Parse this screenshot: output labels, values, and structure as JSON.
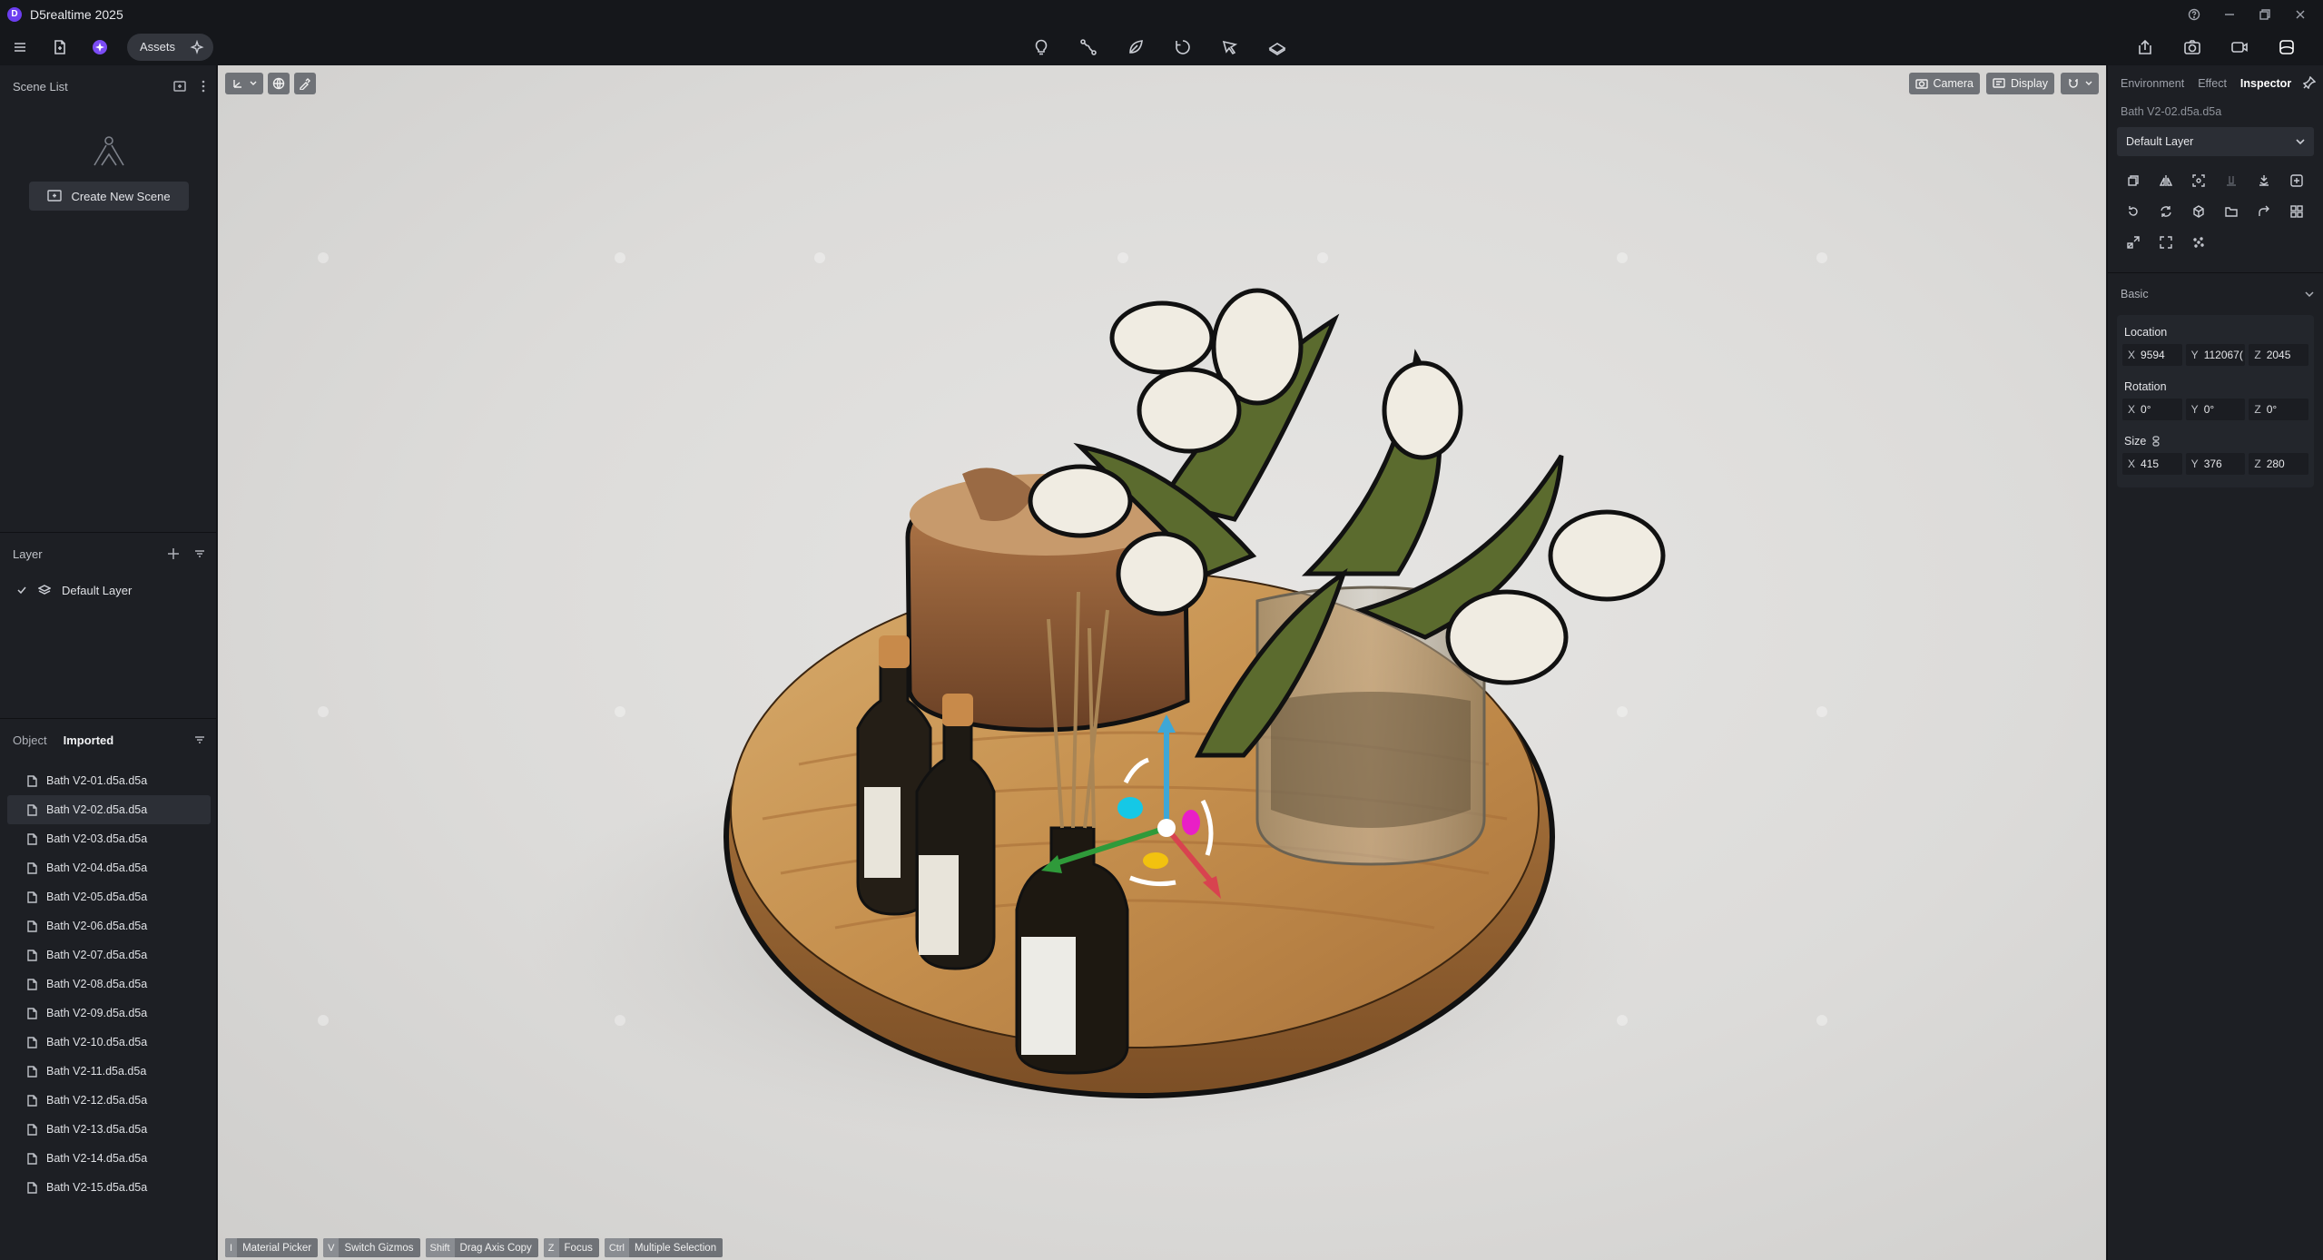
{
  "app": {
    "title": "D5realtime 2025",
    "logo_letter": "D"
  },
  "toolbar": {
    "assets_label": "Assets"
  },
  "scene_list": {
    "title": "Scene List",
    "create_button": "Create New Scene"
  },
  "layer_panel": {
    "title": "Layer",
    "layers": [
      {
        "name": "Default Layer",
        "visible": true
      }
    ]
  },
  "object_panel": {
    "tabs": [
      "Object",
      "Imported"
    ],
    "active_tab": "Imported",
    "items": [
      "Bath V2-01.d5a.d5a",
      "Bath V2-02.d5a.d5a",
      "Bath V2-03.d5a.d5a",
      "Bath V2-04.d5a.d5a",
      "Bath V2-05.d5a.d5a",
      "Bath V2-06.d5a.d5a",
      "Bath V2-07.d5a.d5a",
      "Bath V2-08.d5a.d5a",
      "Bath V2-09.d5a.d5a",
      "Bath V2-10.d5a.d5a",
      "Bath V2-11.d5a.d5a",
      "Bath V2-12.d5a.d5a",
      "Bath V2-13.d5a.d5a",
      "Bath V2-14.d5a.d5a",
      "Bath V2-15.d5a.d5a"
    ],
    "selected_index": 1
  },
  "viewport": {
    "camera_label": "Camera",
    "display_label": "Display",
    "shortcuts": [
      {
        "key": "I",
        "label": "Material Picker"
      },
      {
        "key": "V",
        "label": "Switch Gizmos"
      },
      {
        "key": "Shift",
        "label": "Drag Axis Copy"
      },
      {
        "key": "Z",
        "label": "Focus"
      },
      {
        "key": "Ctrl",
        "label": "Multiple Selection"
      }
    ]
  },
  "inspector": {
    "tabs": [
      "Environment",
      "Effect",
      "Inspector"
    ],
    "active_tab": "Inspector",
    "filename": "Bath V2-02.d5a.d5a",
    "layer_value": "Default Layer",
    "basic_label": "Basic",
    "location": {
      "label": "Location",
      "x": "9594",
      "y": "112067(",
      "z": "2045"
    },
    "rotation": {
      "label": "Rotation",
      "x": "0°",
      "y": "0°",
      "z": "0°"
    },
    "size": {
      "label": "Size",
      "x": "415",
      "y": "376",
      "z": "280"
    }
  },
  "colors": {
    "accent": "#6c3ef0",
    "panel": "#1d1f24",
    "titlebar": "#15171b"
  }
}
